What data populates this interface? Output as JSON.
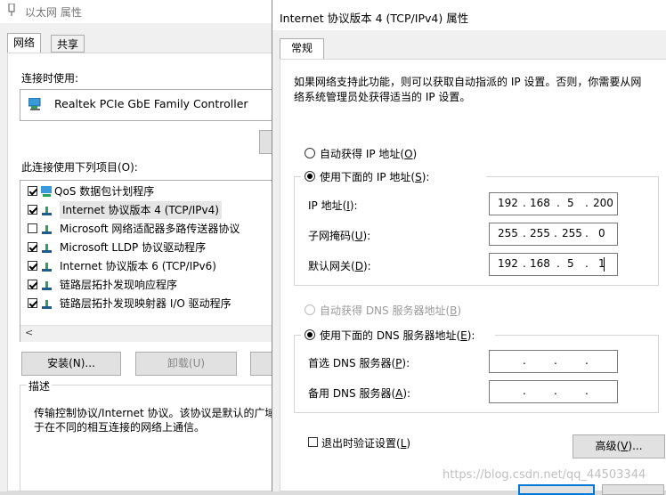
{
  "back": {
    "title": "以太网 属性",
    "tabs": [
      "网络",
      "共享"
    ],
    "connect_using_label": "连接时使用:",
    "adapter_name": "Realtek PCIe GbE Family Controller",
    "items_label": "此连接使用下列项目(O):",
    "items": [
      {
        "label": "QoS 数据包计划程序",
        "checked": true
      },
      {
        "label": "Internet 协议版本 4 (TCP/IPv4)",
        "checked": true
      },
      {
        "label": "Microsoft 网络适配器多路传送器协议",
        "checked": false
      },
      {
        "label": "Microsoft LLDP 协议驱动程序",
        "checked": true
      },
      {
        "label": "Internet 协议版本 6 (TCP/IPv6)",
        "checked": true
      },
      {
        "label": "链路层拓扑发现响应程序",
        "checked": true
      },
      {
        "label": "链路层拓扑发现映射器 I/O 驱动程序",
        "checked": true
      }
    ],
    "scroll_left_glyph": "<",
    "install_label": "安装(N)...",
    "uninstall_label": "卸载(U)",
    "description_label": "描述",
    "description_line1": "传输控制协议/Internet 协议。该协议是默认的广域",
    "description_line2": "于在不同的相互连接的网络上通信。"
  },
  "front": {
    "title": "Internet 协议版本 4 (TCP/IPv4) 属性",
    "tab": "常规",
    "intro_line1": "如果网络支持此功能，则可以获取自动指派的 IP 设置。否则，你需要从网",
    "intro_line2": "络系统管理员处获得适当的 IP 设置。",
    "auto_ip": {
      "pre": "自动获得 IP 地址(",
      "key": "O",
      "post": ")"
    },
    "manual_ip": {
      "pre": "使用下面的 IP 地址(",
      "key": "S",
      "post": "):"
    },
    "ip_label": {
      "pre": "IP 地址(",
      "key": "I",
      "post": "):"
    },
    "mask_label": {
      "pre": "子网掩码(",
      "key": "U",
      "post": "):"
    },
    "gateway_label": {
      "pre": "默认网关(",
      "key": "D",
      "post": "):"
    },
    "ip_value": [
      "192",
      "168",
      "5",
      "200"
    ],
    "mask_value": [
      "255",
      "255",
      "255",
      "0"
    ],
    "gateway_value": [
      "192",
      "168",
      "5",
      "1"
    ],
    "auto_dns": {
      "pre": "自动获得 DNS 服务器地址(",
      "key": "B",
      "post": ")"
    },
    "manual_dns": {
      "pre": "使用下面的 DNS 服务器地址(",
      "key": "E",
      "post": "):"
    },
    "pref_dns_label": {
      "pre": "首选 DNS 服务器(",
      "key": "P",
      "post": "):"
    },
    "alt_dns_label": {
      "pre": "备用 DNS 服务器(",
      "key": "A",
      "post": "):"
    },
    "validate_label": {
      "pre": "退出时验证设置(",
      "key": "L",
      "post": ")"
    },
    "advanced_label": {
      "pre": "高级(",
      "key": "V",
      "post": ")..."
    }
  },
  "watermark": "https://blog.csdn.net/qq_44503344",
  "colors": {
    "accent": "#0078d7",
    "border": "#adadad",
    "panel": "#ffffff",
    "dialog": "#f0f0f0"
  }
}
